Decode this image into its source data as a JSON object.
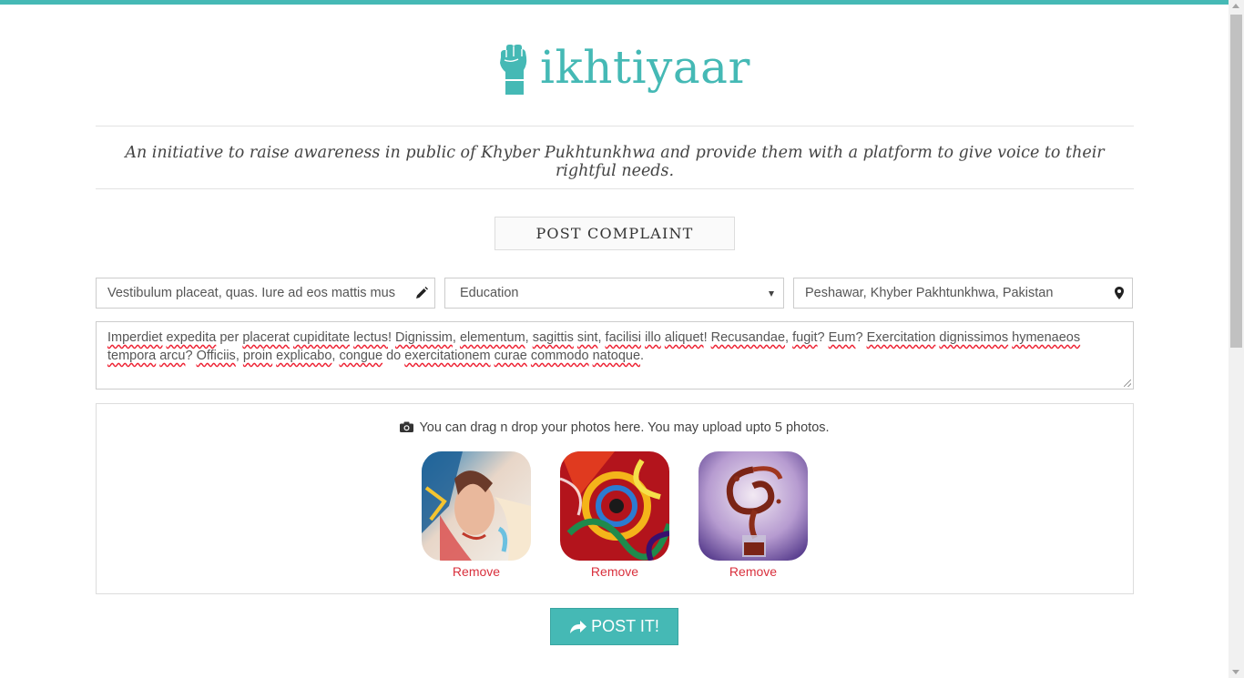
{
  "brand": {
    "name": "ikhtiyaar",
    "accent": "#45b9b5",
    "icon": "raised-fist-icon"
  },
  "tagline": "An initiative to raise awareness in public of Khyber Pukhtunkhwa and provide them with a platform to give voice to their rightful needs.",
  "form": {
    "heading": "POST COMPLAINT",
    "title_value": "Vestibulum placeat, quas. Iure ad eos mattis mus",
    "category_selected": "Education",
    "location_value": "Peshawar, Khyber Pakhtunkhwa, Pakistan",
    "description_value": "Imperdiet expedita per placerat cupiditate lectus! Dignissim, elementum, sagittis sint, facilisi illo aliquet! Recusandae, fugit? Eum? Exercitation dignissimos hymenaeos tempora arcu? Officiis, proin explicabo, congue do exercitationem curae commodo natoque.",
    "photos": {
      "hint": "You can drag n drop your photos here. You may upload upto 5 photos.",
      "remove_label": "Remove",
      "items": [
        {
          "name": "photo-portrait-painting"
        },
        {
          "name": "photo-abstract-swirl"
        },
        {
          "name": "photo-splash-glass"
        }
      ]
    },
    "submit_label": "POST IT!",
    "remove_color": "#d9303d"
  }
}
